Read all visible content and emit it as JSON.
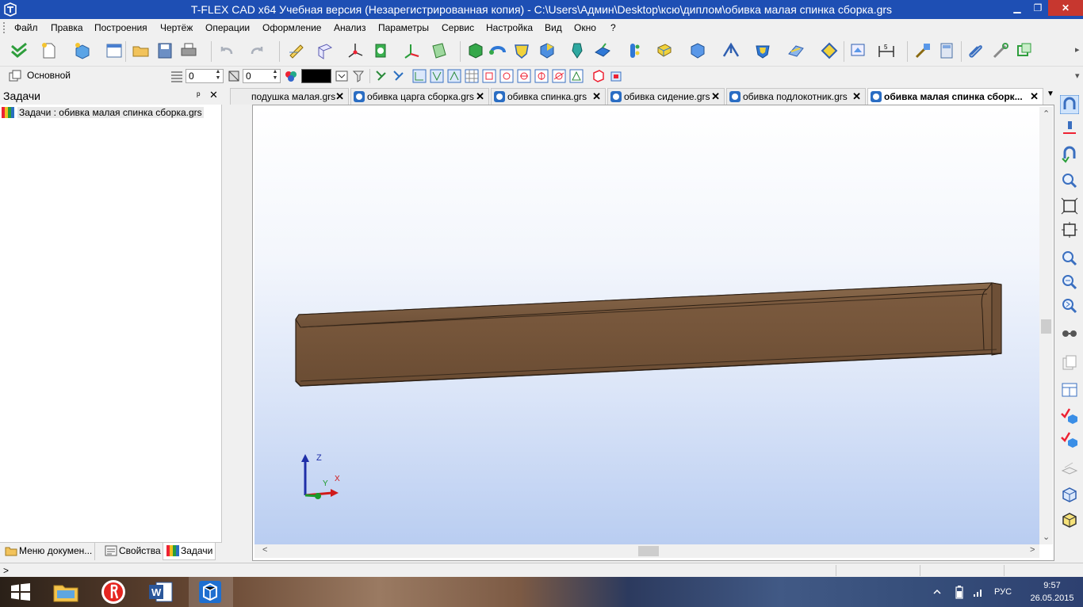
{
  "window": {
    "title": "T-FLEX CAD x64 Учебная версия (Незарегистрированная копия) - C:\\Users\\Админ\\Desktop\\ксю\\диплом\\обивка малая спинка сборка.grs",
    "minimize": "▁",
    "maximize": "❐",
    "close": "✕"
  },
  "menu": [
    "Файл",
    "Правка",
    "Построения",
    "Чертёж",
    "Операции",
    "Оформление",
    "Анализ",
    "Параметры",
    "Сервис",
    "Настройка",
    "Вид",
    "Окно",
    "?"
  ],
  "toolbar2": {
    "layer_label": "Основной",
    "value1": "0",
    "value2": "0",
    "color": "#000000"
  },
  "left_panel": {
    "title": "Задачи",
    "pin": "ᵖ",
    "close": "✕",
    "tree_item": "Задачи : обивка малая спинка сборка.grs",
    "tabs": [
      "Меню докумен...",
      "Свойства",
      "Задачи"
    ]
  },
  "doc_tabs": [
    {
      "label": "подушка малая.grs",
      "active": false
    },
    {
      "label": "обивка царга сборка.grs",
      "active": false
    },
    {
      "label": "обивка спинка.grs",
      "active": false
    },
    {
      "label": "обивка сидение.grs",
      "active": false
    },
    {
      "label": "обивка подлокотник.grs",
      "active": false
    },
    {
      "label": "обивка малая спинка сборк...",
      "active": true
    }
  ],
  "tab_close": "✕",
  "axes": {
    "z": "Z",
    "y": "Y",
    "x": "X"
  },
  "status": {
    "prompt": ">"
  },
  "tray": {
    "lang": "РУС",
    "time": "9:57",
    "date": "26.05.2015"
  },
  "colors": {
    "titlebar": "#1e4fb4",
    "model_wood": "#7a5a3e",
    "viewport_bottom": "#b9cdf1"
  }
}
